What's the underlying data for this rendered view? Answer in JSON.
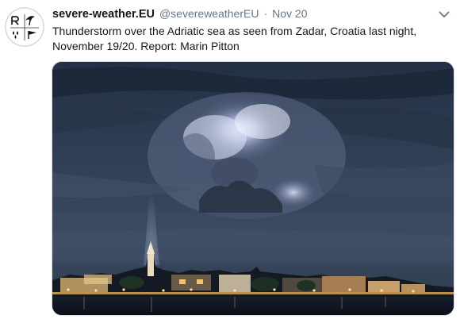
{
  "tweet": {
    "display_name": "severe-weather.EU",
    "handle": "@severeweatherEU",
    "separator": "·",
    "timestamp": "Nov 20",
    "text_line1": "Thunderstorm over the Adriatic sea as seen from Zadar, Croatia last night,",
    "text_line2": "November 19/20. Report: Marin Pitton"
  },
  "icons": {
    "avatar": "severe-weather-logo-icon",
    "menu": "chevron-down-icon"
  },
  "colors": {
    "primary_text": "#14171a",
    "secondary_text": "#657786",
    "sky": "#2c3a4f",
    "lightning_glow": "#e8ecff",
    "city_lights": "#f4b860"
  }
}
